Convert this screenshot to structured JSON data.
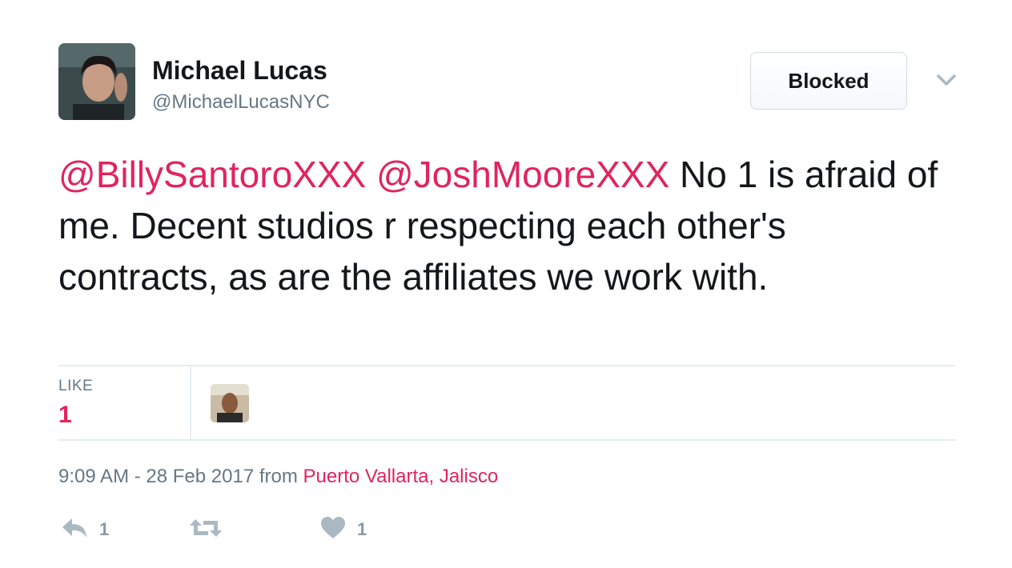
{
  "user": {
    "display_name": "Michael Lucas",
    "handle": "@MichaelLucasNYC"
  },
  "header": {
    "blocked_label": "Blocked",
    "menu_icon": "chevron-down-icon"
  },
  "tweet": {
    "mention_1": "@BillySantoroXXX",
    "mention_2": "@JoshMooreXXX",
    "text": " No 1 is afraid of me. Decent studios r respecting each other's contracts, as are the affiliates we work with."
  },
  "stats": {
    "like_label": "LIKE",
    "like_count": "1"
  },
  "meta": {
    "timestamp": "9:09 AM - 28 Feb 2017",
    "from_label": " from ",
    "place": "Puerto Vallarta, Jalisco"
  },
  "actions": {
    "reply_count": "1",
    "retweet_count": "",
    "like_count": "1"
  },
  "colors": {
    "accent": "#e0245e",
    "muted": "#657786",
    "icon": "#aab8c2",
    "divider": "#e6ecf0"
  }
}
